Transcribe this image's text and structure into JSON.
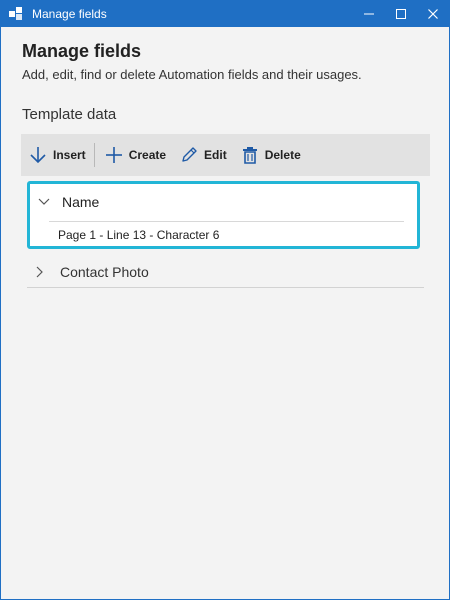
{
  "window": {
    "title": "Manage fields",
    "controls": [
      "minimize-icon",
      "maximize-icon",
      "close-icon"
    ],
    "accent_color": "#1f6fc4"
  },
  "header": {
    "title": "Manage fields",
    "subtitle": "Add, edit, find or delete Automation fields and their usages."
  },
  "section": {
    "label": "Template data"
  },
  "toolbar": {
    "insert_label": "Insert",
    "create_label": "Create",
    "edit_label": "Edit",
    "delete_label": "Delete"
  },
  "fields": [
    {
      "name": "Name",
      "expanded": true,
      "selected": true,
      "usages": [
        "Page 1 - Line 13 - Character 6"
      ]
    },
    {
      "name": "Contact Photo",
      "expanded": false,
      "selected": false,
      "usages": []
    }
  ],
  "colors": {
    "selection_border": "#22b5d6",
    "toolbar_icon": "#1f5aa6"
  }
}
